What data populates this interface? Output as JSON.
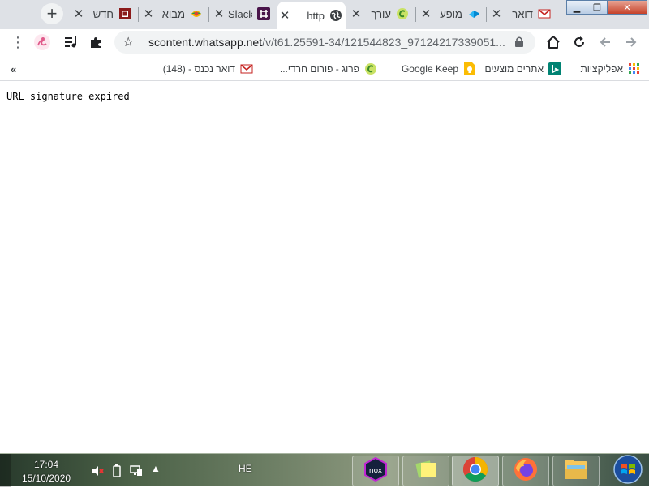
{
  "tabs": [
    {
      "title": "דואר",
      "icon": "gmail-icon",
      "active": false
    },
    {
      "title": "מופע",
      "icon": "cloud-app-icon",
      "active": false
    },
    {
      "title": "עורך",
      "icon": "green-swirl-icon",
      "active": false
    },
    {
      "title": "http",
      "icon": "globe-icon",
      "active": true
    },
    {
      "title": "Slack",
      "icon": "slack-icon",
      "active": false
    },
    {
      "title": "מבוא",
      "icon": "colorful-leaf-icon",
      "active": false
    },
    {
      "title": "חדש",
      "icon": "red-square-icon",
      "active": false
    }
  ],
  "toolbar": {
    "url_host": "scontent.whatsapp.net",
    "url_path": "/v/t61.25591-34/121544823_97124217339051..."
  },
  "bookmarks": [
    {
      "label": "אפליקציות",
      "icon": "apps-grid-icon"
    },
    {
      "label": "אתרים מוצעים",
      "icon": "bing-icon"
    },
    {
      "label": "Google Keep",
      "icon": "keep-bulb-icon"
    },
    {
      "label": "פרוג - פורום חרדי...",
      "icon": "green-swirl-icon"
    },
    {
      "label": "דואר נכנס - (148)",
      "icon": "gmail-icon"
    }
  ],
  "content": {
    "message": "URL signature expired"
  },
  "taskbar": {
    "time": "17:04",
    "date": "15/10/2020",
    "language": "HE",
    "apps": [
      "nox-icon",
      "sticky-notes-icon",
      "chrome-icon",
      "firefox-icon",
      "file-explorer-icon"
    ]
  },
  "colors": {
    "tabstrip_bg": "#dee1e6",
    "omnibox_bg": "#f1f3f4",
    "window_close": "#c6422a"
  }
}
